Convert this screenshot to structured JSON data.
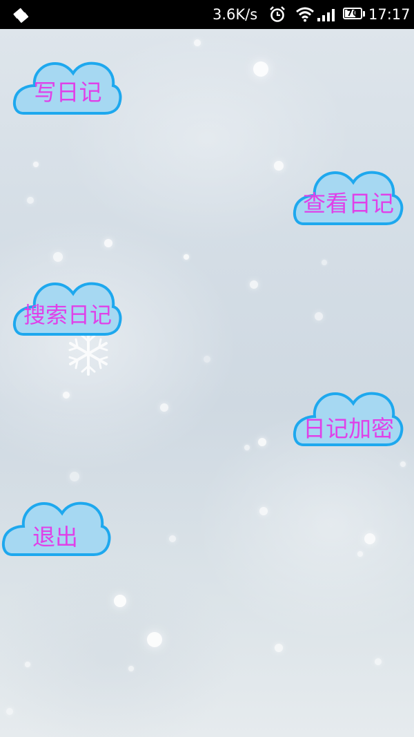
{
  "status_bar": {
    "net_speed": "3.6K/s",
    "battery_level": "70",
    "battery_fraction": 0.7,
    "time": "17:17",
    "icons": [
      "notification-icon",
      "alarm-icon",
      "wifi-icon",
      "signal-icon",
      "battery-icon"
    ]
  },
  "menu": {
    "write_diary": "写日记",
    "view_diary": "查看日记",
    "search_diary": "搜索日记",
    "encrypt_diary": "日记加密",
    "exit": "退出"
  },
  "colors": {
    "cloud_fill": "#a6d8f2",
    "cloud_outline": "#1ea8ee",
    "label_text": "#e040e8",
    "status_bar_bg": "#000000"
  }
}
